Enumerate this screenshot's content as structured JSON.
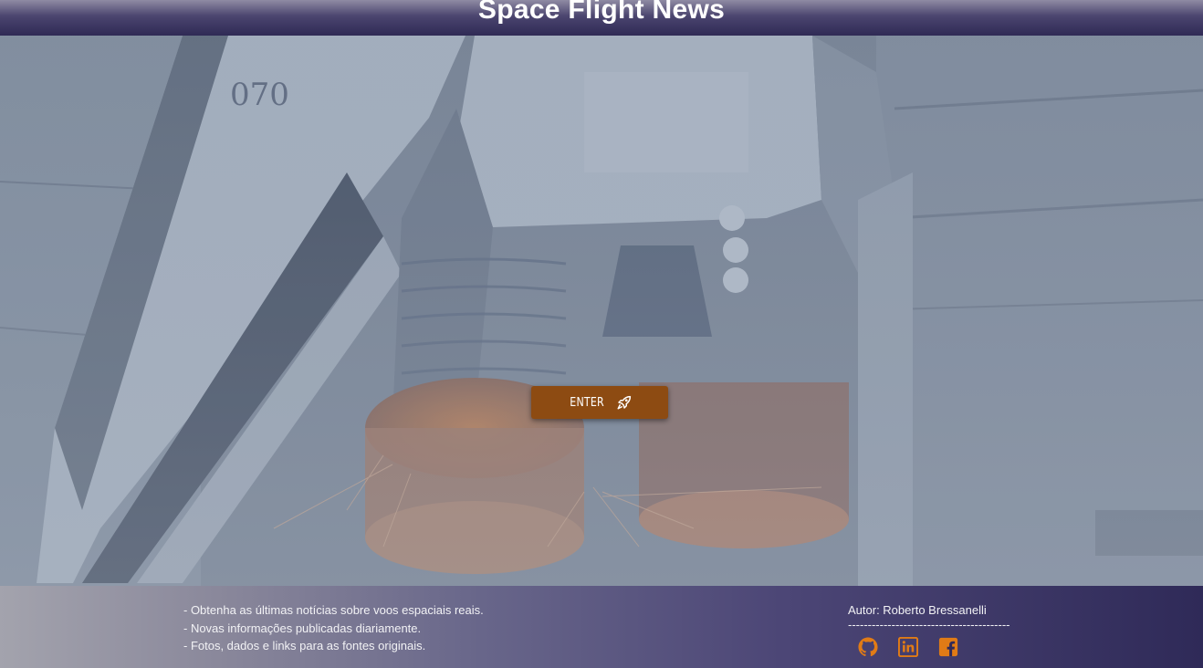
{
  "header": {
    "title": "Space Flight News"
  },
  "hero": {
    "enter_label": "ENTER",
    "enter_icon": "rocket-icon",
    "tail_number": "070"
  },
  "footer": {
    "features": [
      "- Obtenha as últimas notícias sobre voos espaciais reais.",
      "- Novas informações publicadas diariamente.",
      "- Fotos, dados e links para as fontes originais."
    ],
    "author": "Autor: Roberto Bressanelli",
    "divider": "-----------------------------------------",
    "social": [
      {
        "name": "github-icon"
      },
      {
        "name": "linkedin-icon"
      },
      {
        "name": "facebook-icon"
      }
    ]
  },
  "colors": {
    "accent": "#8d4b12",
    "social_icon": "#e07b16",
    "header_bg": "#2f2a55"
  }
}
